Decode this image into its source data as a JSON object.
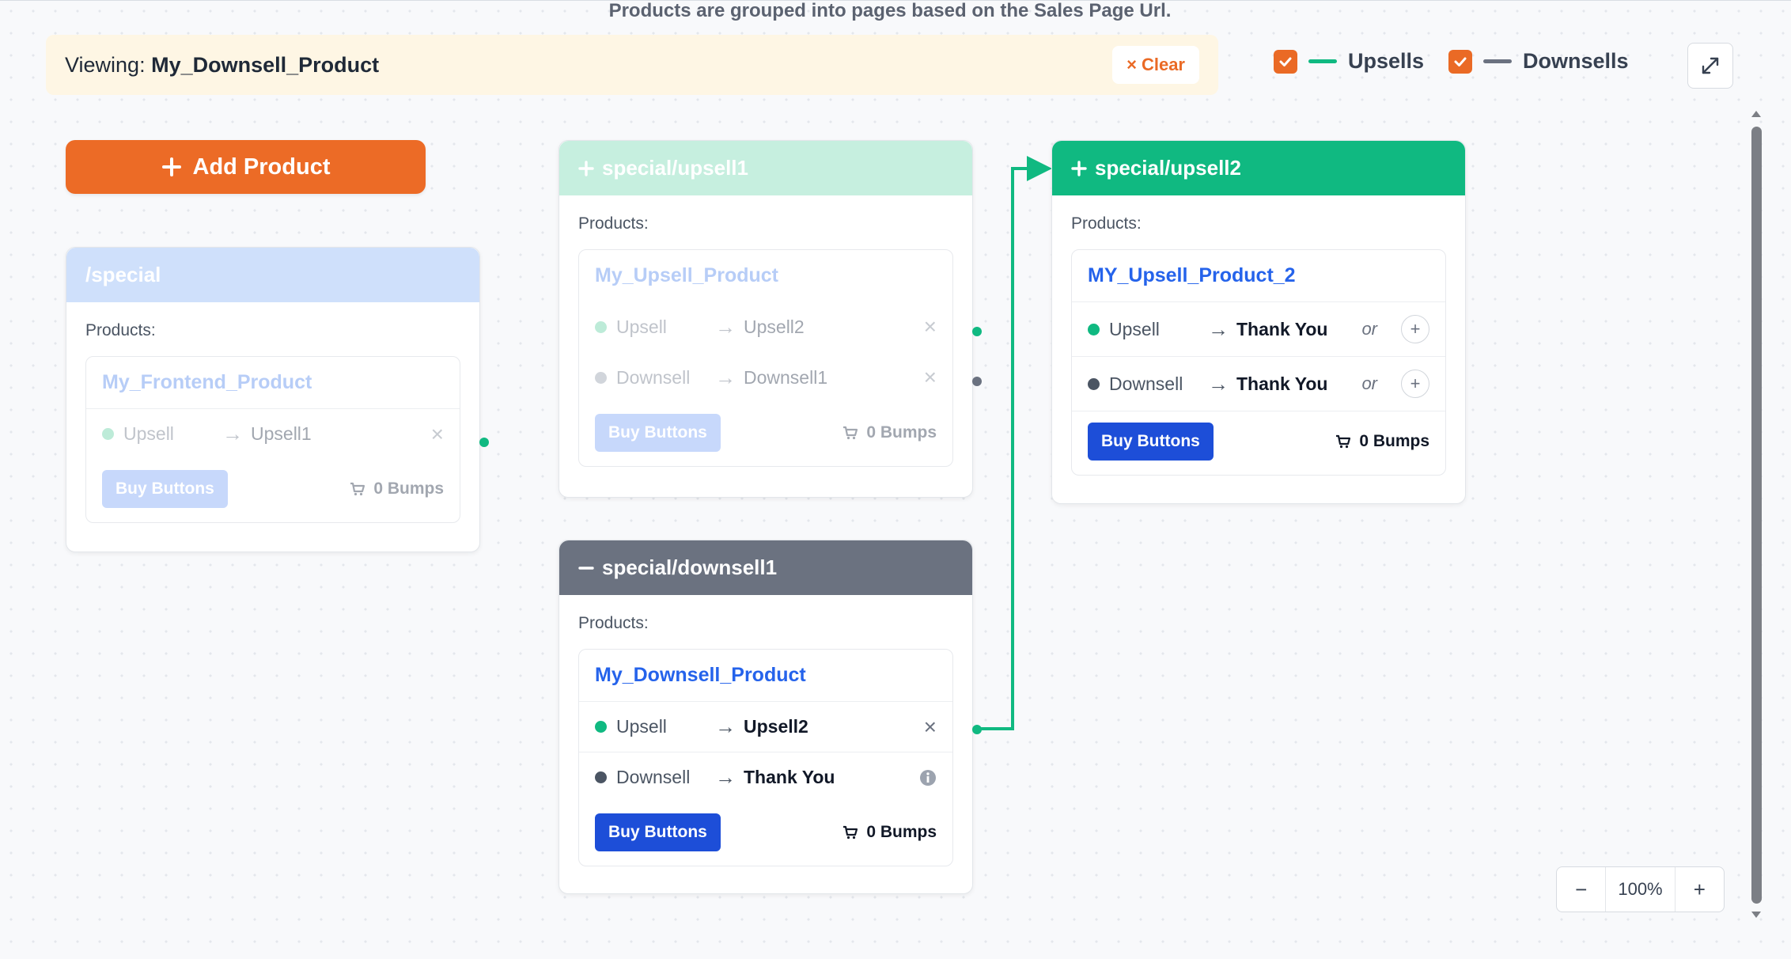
{
  "notice": "Products are grouped into pages based on the Sales Page Url.",
  "viewing": {
    "prefix": "Viewing:",
    "product": "My_Downsell_Product",
    "clear_label": "Clear"
  },
  "legend": {
    "upsells_label": "Upsells",
    "upsells_color": "#10b981",
    "upsells_checked": true,
    "downsells_label": "Downsells",
    "downsells_color": "#6b7280",
    "downsells_checked": true
  },
  "add_product_label": "Add Product",
  "products_label": "Products:",
  "buy_buttons_label": "Buy Buttons",
  "or_label": "or",
  "nodes": {
    "special": {
      "title": "/special",
      "header_color": "#cfe0fb",
      "product": {
        "name": "My_Frontend_Product",
        "rows": [
          {
            "type": "Upsell",
            "target": "Upsell1"
          }
        ],
        "bumps": "0 Bumps"
      }
    },
    "upsell1": {
      "title": "special/upsell1",
      "header_color": "#c6efdf",
      "product": {
        "name": "My_Upsell_Product",
        "rows": [
          {
            "type": "Upsell",
            "target": "Upsell2"
          },
          {
            "type": "Downsell",
            "target": "Downsell1"
          }
        ],
        "bumps": "0 Bumps"
      }
    },
    "downsell1": {
      "title": "special/downsell1",
      "header_color": "#6b7280",
      "product": {
        "name": "My_Downsell_Product",
        "rows": [
          {
            "type": "Upsell",
            "target": "Upsell2"
          },
          {
            "type": "Downsell",
            "target": "Thank You"
          }
        ],
        "bumps": "0 Bumps"
      }
    },
    "upsell2": {
      "title": "special/upsell2",
      "header_color": "#10b981",
      "product": {
        "name": "MY_Upsell_Product_2",
        "rows": [
          {
            "type": "Upsell",
            "target": "Thank You"
          },
          {
            "type": "Downsell",
            "target": "Thank You"
          }
        ],
        "bumps": "0 Bumps"
      }
    }
  },
  "zoom": {
    "minus": "−",
    "value": "100%",
    "plus": "+"
  }
}
